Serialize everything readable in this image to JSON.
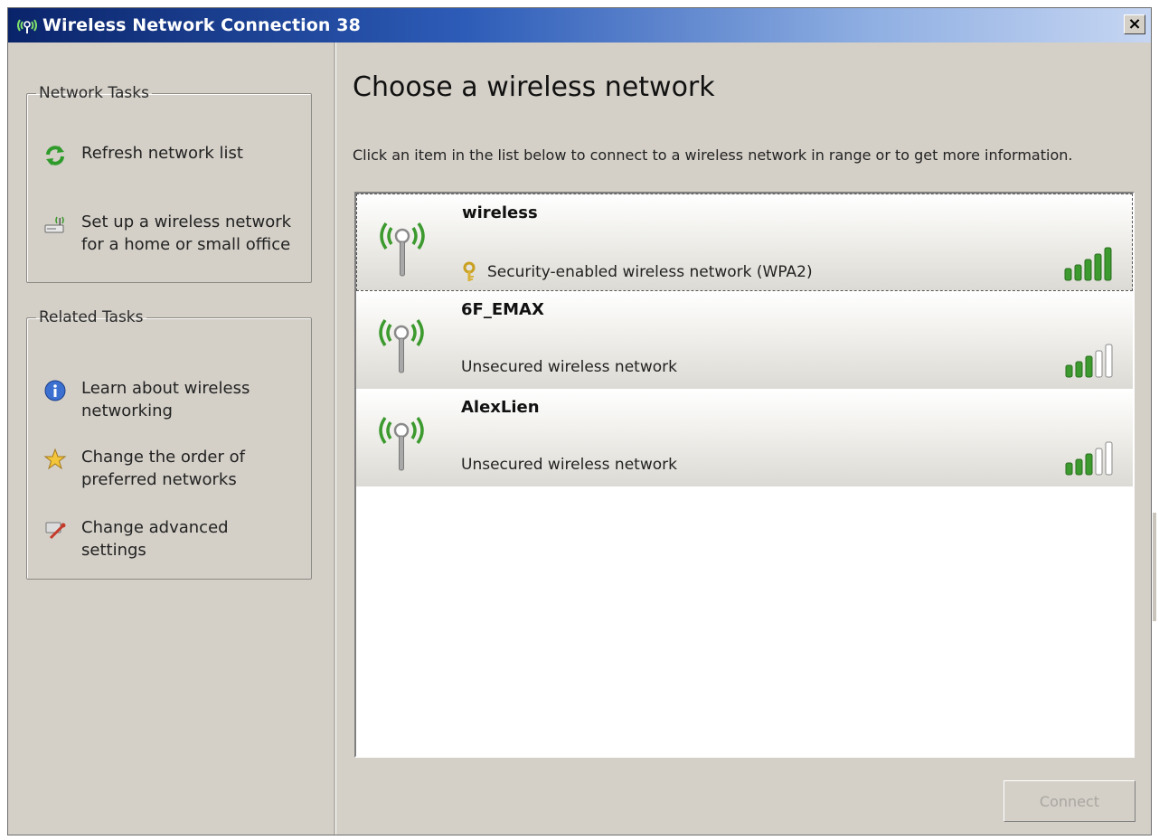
{
  "window": {
    "title": "Wireless Network Connection 38",
    "close_label": "×"
  },
  "sidebar": {
    "network_tasks": {
      "title": "Network Tasks",
      "items": [
        {
          "label": "Refresh network list",
          "icon": "refresh-icon"
        },
        {
          "label": "Set up a wireless network\nfor a home or small office",
          "icon": "wireless-setup-icon"
        }
      ]
    },
    "related_tasks": {
      "title": "Related Tasks",
      "items": [
        {
          "label": "Learn about wireless\nnetworking",
          "icon": "info-icon"
        },
        {
          "label": "Change the order of\npreferred networks",
          "icon": "star-icon"
        },
        {
          "label": "Change advanced\nsettings",
          "icon": "settings-icon"
        }
      ]
    }
  },
  "main": {
    "heading": "Choose a wireless network",
    "instruction": "Click an item in the list below to connect to a wireless network in range or to get more information.",
    "networks": [
      {
        "name": "wireless",
        "status": "Security-enabled wireless network (WPA2)",
        "secured": true,
        "signal_bars": 5
      },
      {
        "name": "6F_EMAX",
        "status": "Unsecured wireless network",
        "secured": false,
        "signal_bars": 3
      },
      {
        "name": "AlexLien",
        "status": "Unsecured wireless network",
        "secured": false,
        "signal_bars": 3
      }
    ],
    "connect_label": "Connect"
  },
  "colors": {
    "titlebar_start": "#0a246a",
    "signal_green": "#3c9a2e",
    "window_bg": "#d4d0c8"
  }
}
